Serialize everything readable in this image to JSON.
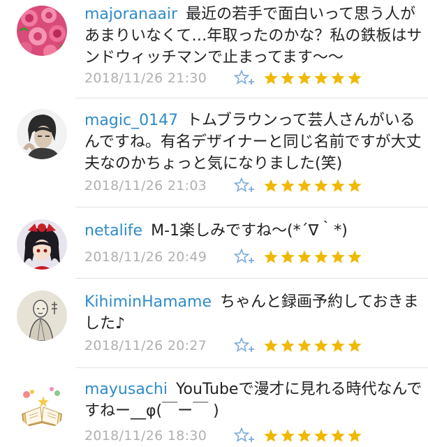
{
  "colors": {
    "username": "#2f8bc9",
    "star": "#f0b800",
    "star_add": "#7aa9d8",
    "timestamp": "#b0b0b0"
  },
  "comments": [
    {
      "username": "majoranaair",
      "text": "最近の若手で面白いって思う人があまりいなくて…年取ったのかな？私の鉄板はサンドウィッチマンで止まってます〜〜",
      "timestamp": "2018/11/26 21:30",
      "avatar_icon": "rose-bouquet-avatar",
      "star_count": 6
    },
    {
      "username": "magic_0147",
      "text": "トムブラウンって芸人さんがいるんですね。有名デザイナーと同じ名前ですが大丈夫なのかちょっと気になりました(笑)",
      "timestamp": "2018/11/26 21:03",
      "avatar_icon": "person-photo-avatar",
      "star_count": 6
    },
    {
      "username": "netalife",
      "text": "M-1楽しみですね〜(*´∇｀*)",
      "timestamp": "2018/11/26 20:49",
      "avatar_icon": "anime-character-avatar",
      "star_count": 6
    },
    {
      "username": "KihiminHamame",
      "text": "ちゃんと録画予約しておきました♪",
      "timestamp": "2018/11/26 20:27",
      "avatar_icon": "monk-sketch-avatar",
      "star_count": 6
    },
    {
      "username": "mayusachi",
      "text": "YouTubeで漫才に見れる時代なんですねー__φ(￣ー￣ )",
      "timestamp": "2018/11/26 18:30",
      "avatar_icon": "open-book-avatar",
      "star_count": 6
    }
  ]
}
